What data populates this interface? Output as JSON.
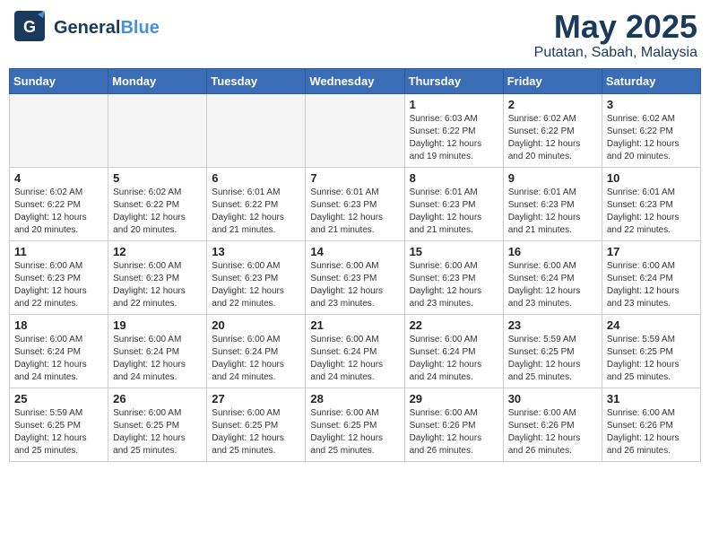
{
  "header": {
    "logo_general": "General",
    "logo_blue": "Blue",
    "month": "May 2025",
    "location": "Putatan, Sabah, Malaysia"
  },
  "weekdays": [
    "Sunday",
    "Monday",
    "Tuesday",
    "Wednesday",
    "Thursday",
    "Friday",
    "Saturday"
  ],
  "weeks": [
    [
      {
        "day": "",
        "info": ""
      },
      {
        "day": "",
        "info": ""
      },
      {
        "day": "",
        "info": ""
      },
      {
        "day": "",
        "info": ""
      },
      {
        "day": "1",
        "info": "Sunrise: 6:03 AM\nSunset: 6:22 PM\nDaylight: 12 hours\nand 19 minutes."
      },
      {
        "day": "2",
        "info": "Sunrise: 6:02 AM\nSunset: 6:22 PM\nDaylight: 12 hours\nand 20 minutes."
      },
      {
        "day": "3",
        "info": "Sunrise: 6:02 AM\nSunset: 6:22 PM\nDaylight: 12 hours\nand 20 minutes."
      }
    ],
    [
      {
        "day": "4",
        "info": "Sunrise: 6:02 AM\nSunset: 6:22 PM\nDaylight: 12 hours\nand 20 minutes."
      },
      {
        "day": "5",
        "info": "Sunrise: 6:02 AM\nSunset: 6:22 PM\nDaylight: 12 hours\nand 20 minutes."
      },
      {
        "day": "6",
        "info": "Sunrise: 6:01 AM\nSunset: 6:22 PM\nDaylight: 12 hours\nand 21 minutes."
      },
      {
        "day": "7",
        "info": "Sunrise: 6:01 AM\nSunset: 6:23 PM\nDaylight: 12 hours\nand 21 minutes."
      },
      {
        "day": "8",
        "info": "Sunrise: 6:01 AM\nSunset: 6:23 PM\nDaylight: 12 hours\nand 21 minutes."
      },
      {
        "day": "9",
        "info": "Sunrise: 6:01 AM\nSunset: 6:23 PM\nDaylight: 12 hours\nand 21 minutes."
      },
      {
        "day": "10",
        "info": "Sunrise: 6:01 AM\nSunset: 6:23 PM\nDaylight: 12 hours\nand 22 minutes."
      }
    ],
    [
      {
        "day": "11",
        "info": "Sunrise: 6:00 AM\nSunset: 6:23 PM\nDaylight: 12 hours\nand 22 minutes."
      },
      {
        "day": "12",
        "info": "Sunrise: 6:00 AM\nSunset: 6:23 PM\nDaylight: 12 hours\nand 22 minutes."
      },
      {
        "day": "13",
        "info": "Sunrise: 6:00 AM\nSunset: 6:23 PM\nDaylight: 12 hours\nand 22 minutes."
      },
      {
        "day": "14",
        "info": "Sunrise: 6:00 AM\nSunset: 6:23 PM\nDaylight: 12 hours\nand 23 minutes."
      },
      {
        "day": "15",
        "info": "Sunrise: 6:00 AM\nSunset: 6:23 PM\nDaylight: 12 hours\nand 23 minutes."
      },
      {
        "day": "16",
        "info": "Sunrise: 6:00 AM\nSunset: 6:24 PM\nDaylight: 12 hours\nand 23 minutes."
      },
      {
        "day": "17",
        "info": "Sunrise: 6:00 AM\nSunset: 6:24 PM\nDaylight: 12 hours\nand 23 minutes."
      }
    ],
    [
      {
        "day": "18",
        "info": "Sunrise: 6:00 AM\nSunset: 6:24 PM\nDaylight: 12 hours\nand 24 minutes."
      },
      {
        "day": "19",
        "info": "Sunrise: 6:00 AM\nSunset: 6:24 PM\nDaylight: 12 hours\nand 24 minutes."
      },
      {
        "day": "20",
        "info": "Sunrise: 6:00 AM\nSunset: 6:24 PM\nDaylight: 12 hours\nand 24 minutes."
      },
      {
        "day": "21",
        "info": "Sunrise: 6:00 AM\nSunset: 6:24 PM\nDaylight: 12 hours\nand 24 minutes."
      },
      {
        "day": "22",
        "info": "Sunrise: 6:00 AM\nSunset: 6:24 PM\nDaylight: 12 hours\nand 24 minutes."
      },
      {
        "day": "23",
        "info": "Sunrise: 5:59 AM\nSunset: 6:25 PM\nDaylight: 12 hours\nand 25 minutes."
      },
      {
        "day": "24",
        "info": "Sunrise: 5:59 AM\nSunset: 6:25 PM\nDaylight: 12 hours\nand 25 minutes."
      }
    ],
    [
      {
        "day": "25",
        "info": "Sunrise: 5:59 AM\nSunset: 6:25 PM\nDaylight: 12 hours\nand 25 minutes."
      },
      {
        "day": "26",
        "info": "Sunrise: 6:00 AM\nSunset: 6:25 PM\nDaylight: 12 hours\nand 25 minutes."
      },
      {
        "day": "27",
        "info": "Sunrise: 6:00 AM\nSunset: 6:25 PM\nDaylight: 12 hours\nand 25 minutes."
      },
      {
        "day": "28",
        "info": "Sunrise: 6:00 AM\nSunset: 6:25 PM\nDaylight: 12 hours\nand 25 minutes."
      },
      {
        "day": "29",
        "info": "Sunrise: 6:00 AM\nSunset: 6:26 PM\nDaylight: 12 hours\nand 26 minutes."
      },
      {
        "day": "30",
        "info": "Sunrise: 6:00 AM\nSunset: 6:26 PM\nDaylight: 12 hours\nand 26 minutes."
      },
      {
        "day": "31",
        "info": "Sunrise: 6:00 AM\nSunset: 6:26 PM\nDaylight: 12 hours\nand 26 minutes."
      }
    ]
  ]
}
